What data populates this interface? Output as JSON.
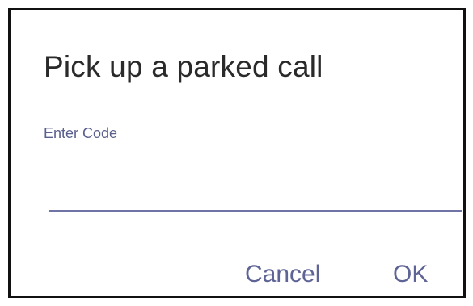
{
  "dialog": {
    "title": "Pick up a parked call",
    "field_label": "Enter Code",
    "code_value": "",
    "cancel_label": "Cancel",
    "ok_label": "OK"
  },
  "colors": {
    "title_text": "#2a2a2a",
    "accent": "#5f6496",
    "underline": "#6f73a6",
    "border": "#111111"
  }
}
